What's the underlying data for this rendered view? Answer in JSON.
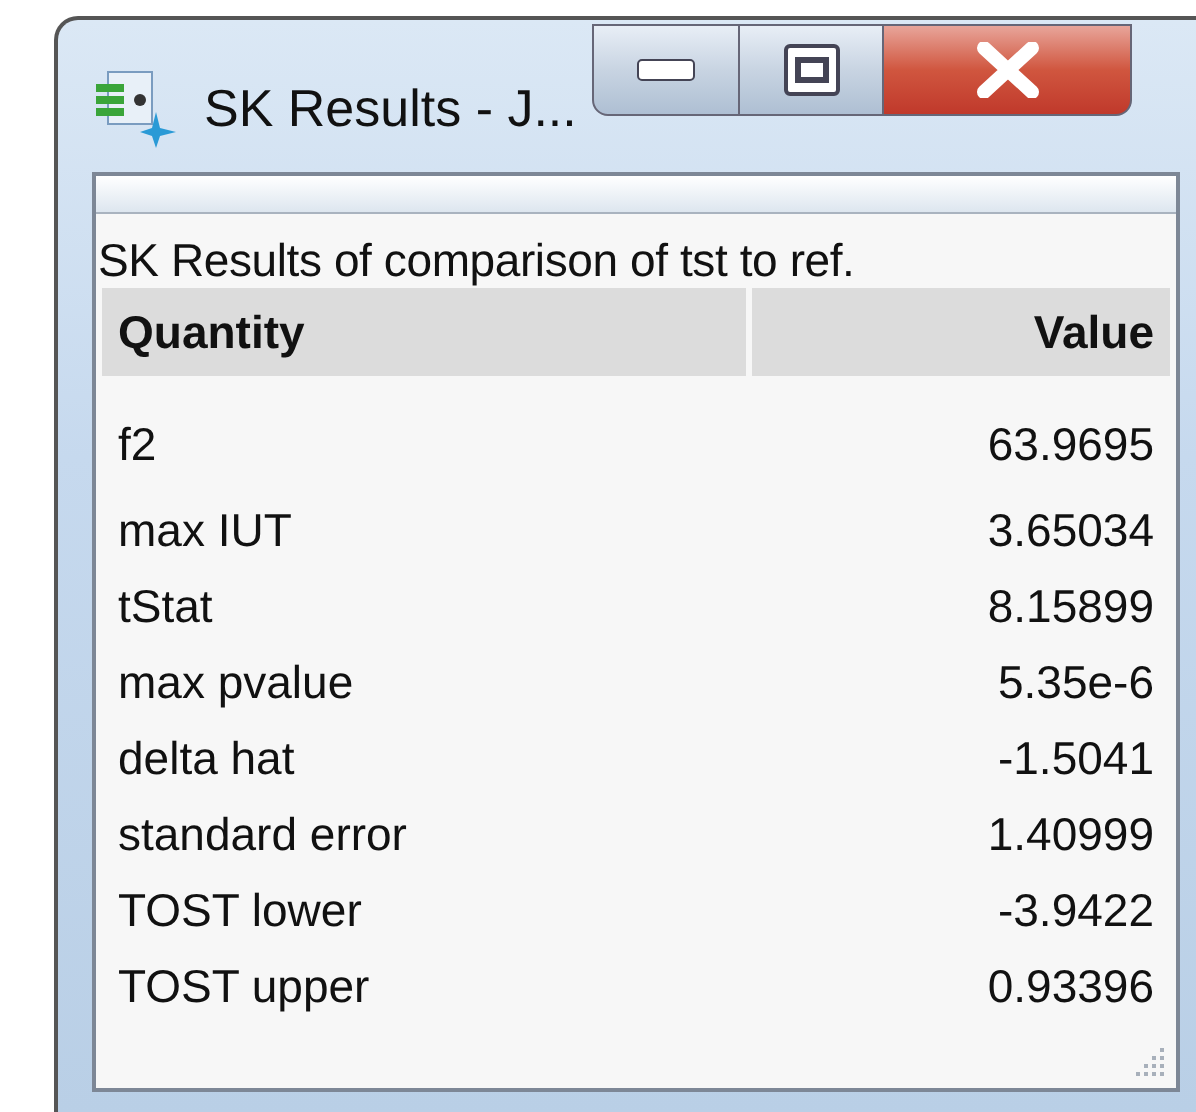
{
  "window": {
    "title": "SK Results - J..."
  },
  "caption": "SK Results of comparison of tst to ref.",
  "table": {
    "columns": [
      "Quantity",
      "Value"
    ],
    "rows": [
      [
        "f2",
        "63.9695"
      ],
      [
        "max IUT",
        "3.65034"
      ],
      [
        "tStat",
        "8.15899"
      ],
      [
        "max pvalue",
        "5.35e-6"
      ],
      [
        "delta hat",
        "-1.5041"
      ],
      [
        "standard error",
        "1.40999"
      ],
      [
        "TOST lower",
        "-3.9422"
      ],
      [
        "TOST upper",
        "0.93396"
      ]
    ]
  }
}
